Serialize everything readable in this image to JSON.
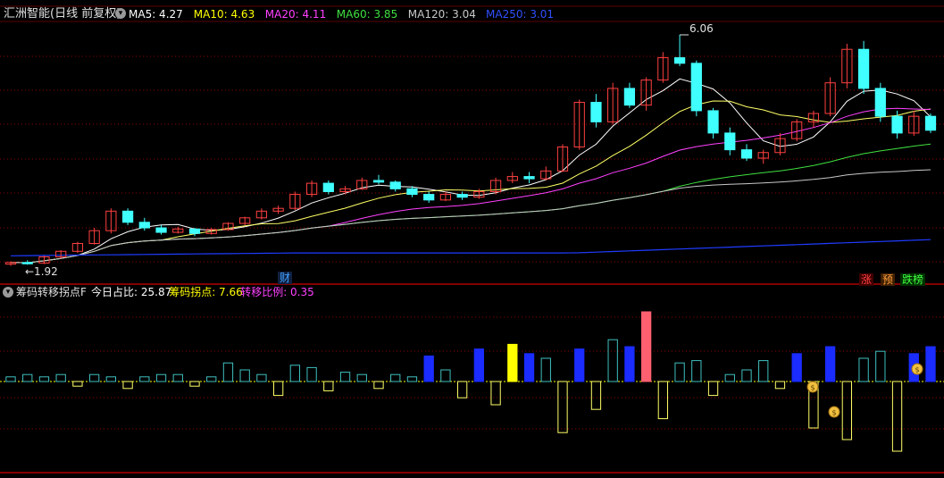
{
  "header": {
    "title": "汇洲智能(日线 前复权)",
    "ma": [
      {
        "label": "MA5: 4.27",
        "color": "#ffffff"
      },
      {
        "label": "MA10: 4.63",
        "color": "#ffff00"
      },
      {
        "label": "MA20: 4.11",
        "color": "#ff40ff"
      },
      {
        "label": "MA60: 3.85",
        "color": "#40e040"
      },
      {
        "label": "MA120: 3.04",
        "color": "#c8c8c8"
      },
      {
        "label": "MA250: 3.01",
        "color": "#3050ff"
      }
    ]
  },
  "indicator": {
    "name": "筹码转移拐点F",
    "items": [
      {
        "label": "今日占比: 25.87",
        "color": "#ffffff"
      },
      {
        "label": "筹码拐点: 7.66",
        "color": "#ffff00"
      },
      {
        "label": "转移比例: 0.35",
        "color": "#ff40ff"
      }
    ]
  },
  "badges": {
    "cai": "财",
    "zhang": "涨",
    "yu": "预",
    "dieban": "跌榜"
  },
  "colors": {
    "up": "#ff4040",
    "down": "#40ffff",
    "grid": "#8b0000",
    "axis": "#b00000",
    "ma250": "#1f3cff"
  },
  "chart_data": {
    "type": "candlestick",
    "annotations": [
      {
        "text": "6.06",
        "kind": "high"
      },
      {
        "text": "←1.92",
        "kind": "low"
      }
    ],
    "candles_ohlc_sampled": [
      [
        1.95,
        2.0,
        1.92,
        1.98
      ],
      [
        1.98,
        2.02,
        1.94,
        1.97
      ],
      [
        1.97,
        2.1,
        1.95,
        2.08
      ],
      [
        2.08,
        2.2,
        2.05,
        2.18
      ],
      [
        2.18,
        2.35,
        2.15,
        2.32
      ],
      [
        2.32,
        2.6,
        2.3,
        2.55
      ],
      [
        2.55,
        2.95,
        2.5,
        2.9
      ],
      [
        2.9,
        2.95,
        2.65,
        2.7
      ],
      [
        2.7,
        2.78,
        2.55,
        2.6
      ],
      [
        2.6,
        2.65,
        2.48,
        2.52
      ],
      [
        2.52,
        2.62,
        2.5,
        2.58
      ],
      [
        2.58,
        2.6,
        2.45,
        2.5
      ],
      [
        2.5,
        2.6,
        2.48,
        2.57
      ],
      [
        2.57,
        2.7,
        2.55,
        2.68
      ],
      [
        2.68,
        2.8,
        2.65,
        2.78
      ],
      [
        2.78,
        2.95,
        2.75,
        2.9
      ],
      [
        2.9,
        3.0,
        2.85,
        2.95
      ],
      [
        2.95,
        3.25,
        2.92,
        3.2
      ],
      [
        3.2,
        3.45,
        3.15,
        3.4
      ],
      [
        3.4,
        3.45,
        3.2,
        3.25
      ],
      [
        3.25,
        3.35,
        3.2,
        3.3
      ],
      [
        3.3,
        3.5,
        3.28,
        3.45
      ],
      [
        3.45,
        3.55,
        3.38,
        3.42
      ],
      [
        3.42,
        3.45,
        3.25,
        3.3
      ],
      [
        3.3,
        3.35,
        3.15,
        3.2
      ],
      [
        3.2,
        3.25,
        3.05,
        3.1
      ],
      [
        3.1,
        3.25,
        3.08,
        3.2
      ],
      [
        3.2,
        3.25,
        3.1,
        3.15
      ],
      [
        3.15,
        3.3,
        3.12,
        3.25
      ],
      [
        3.25,
        3.5,
        3.2,
        3.45
      ],
      [
        3.45,
        3.6,
        3.4,
        3.52
      ],
      [
        3.52,
        3.6,
        3.4,
        3.48
      ],
      [
        3.48,
        3.7,
        3.45,
        3.62
      ],
      [
        3.62,
        4.1,
        3.6,
        4.05
      ],
      [
        4.05,
        4.9,
        4.0,
        4.85
      ],
      [
        4.85,
        5.0,
        4.4,
        4.5
      ],
      [
        4.5,
        5.2,
        4.45,
        5.1
      ],
      [
        5.1,
        5.2,
        4.75,
        4.8
      ],
      [
        4.8,
        5.3,
        4.7,
        5.25
      ],
      [
        5.25,
        5.75,
        5.2,
        5.65
      ],
      [
        5.65,
        6.06,
        5.5,
        5.55
      ],
      [
        5.55,
        5.6,
        4.6,
        4.7
      ],
      [
        4.7,
        4.75,
        4.2,
        4.3
      ],
      [
        4.3,
        4.4,
        3.9,
        4.0
      ],
      [
        4.0,
        4.1,
        3.8,
        3.85
      ],
      [
        3.85,
        4.0,
        3.75,
        3.95
      ],
      [
        3.95,
        4.3,
        3.9,
        4.2
      ],
      [
        4.2,
        4.55,
        4.15,
        4.5
      ],
      [
        4.5,
        4.7,
        4.4,
        4.65
      ],
      [
        4.65,
        5.3,
        4.6,
        5.2
      ],
      [
        5.2,
        5.9,
        5.1,
        5.8
      ],
      [
        5.8,
        5.95,
        5.0,
        5.1
      ],
      [
        5.1,
        5.2,
        4.5,
        4.6
      ],
      [
        4.6,
        4.7,
        4.2,
        4.3
      ],
      [
        4.3,
        4.7,
        4.25,
        4.6
      ],
      [
        4.6,
        4.65,
        4.3,
        4.35
      ]
    ],
    "indicator_bars_sampled": [
      2,
      3,
      2,
      3,
      -2,
      3,
      2,
      -3,
      2,
      3,
      3,
      -2,
      2,
      8,
      5,
      3,
      -6,
      7,
      6,
      -4,
      4,
      3,
      -3,
      3,
      2,
      11,
      5,
      -7,
      14,
      -10,
      16,
      12,
      10,
      -22,
      14,
      -12,
      18,
      15,
      30,
      -16,
      8,
      9,
      -6,
      3,
      5,
      9,
      -3,
      12,
      -20,
      15,
      -25,
      10,
      13,
      -30,
      12,
      15
    ]
  }
}
